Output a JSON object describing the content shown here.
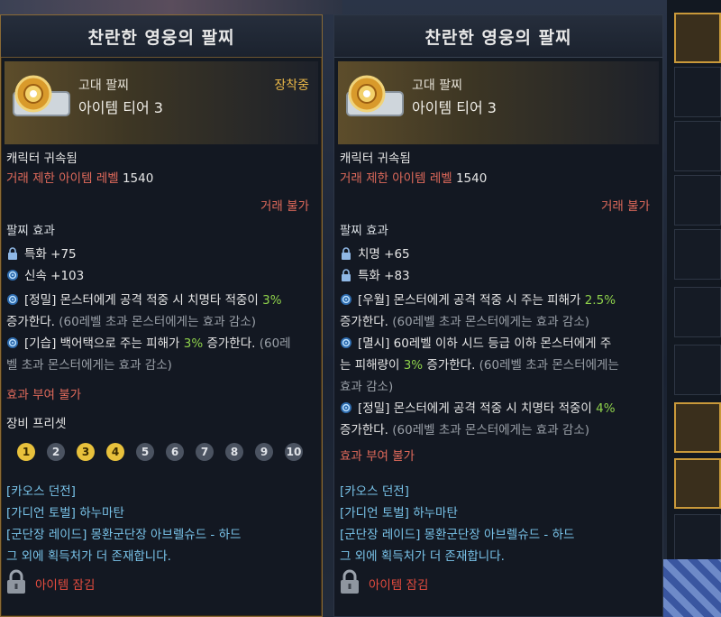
{
  "left": {
    "title": "찬란한 영웅의 팔찌",
    "grade": "고대 팔찌",
    "tier": "아이템 티어 3",
    "equipped": "장착중",
    "bound": "캐릭터 귀속됨",
    "level_label": "거래 제한 아이템 레벨",
    "level_value": "1540",
    "trade": "거래 불가",
    "effect_title": "팔찌 효과",
    "stats": [
      {
        "icon": "lock-icon",
        "text": "특화 +75"
      },
      {
        "icon": "swirl-icon",
        "text": "신속 +103"
      }
    ],
    "effects": [
      {
        "lead": "[정밀] 몬스터에게 공격 적중 시 치명타 적중이 ",
        "val": "3%",
        "line2": "증가한다.",
        "tail": " (60레벨 초과 몬스터에게는 효과 감소)"
      },
      {
        "lead": "[기습] 백어택으로 주는 피해가 ",
        "val": "3%",
        "mid": " 증가한다.",
        "tail": " (60레",
        "line2": "벨 초과 몬스터에게는 효과 감소)"
      }
    ],
    "no_grant": "효과 부여 불가",
    "preset_title": "장비 프리셋",
    "presets": [
      "1",
      "2",
      "3",
      "4",
      "5",
      "6",
      "7",
      "8",
      "9",
      "10"
    ],
    "presets_active": [
      1,
      3,
      4
    ],
    "sources": [
      "[카오스 던전]",
      "[가디언 토벌] 하누마탄",
      "[군단장 레이드] 몽환군단장 아브렐슈드 - 하드",
      "그 외에 획득처가 더 존재합니다."
    ],
    "lock_text": "아이템 잠김"
  },
  "right": {
    "title": "찬란한 영웅의 팔찌",
    "grade": "고대 팔찌",
    "tier": "아이템 티어 3",
    "bound": "캐릭터 귀속됨",
    "level_label": "거래 제한 아이템 레벨",
    "level_value": "1540",
    "trade": "거래 불가",
    "effect_title": "팔찌 효과",
    "stats": [
      {
        "icon": "lock-icon",
        "text": "치명 +65"
      },
      {
        "icon": "lock-icon",
        "text": "특화 +83"
      }
    ],
    "effect1": {
      "lead": "[우월] 몬스터에게 공격 적중 시 주는 피해가 ",
      "val": "2.5%",
      "line2": "증가한다.",
      "tail": " (60레벨 초과 몬스터에게는 효과 감소)"
    },
    "effect2": {
      "lead": "[멸시] 60레벨 이하 시드 등급 이하 몬스터에게 주",
      "line2a": "는 피해량이 ",
      "val": "3%",
      "mid": " 증가한다.",
      "tail": " (60레벨 초과 몬스터에게는",
      "line3": "효과 감소)"
    },
    "effect3": {
      "lead": "[정밀] 몬스터에게 공격 적중 시 치명타 적중이 ",
      "val": "4%",
      "line2": "증가한다.",
      "tail": " (60레벨 초과 몬스터에게는 효과 감소)"
    },
    "no_grant": "효과 부여 불가",
    "sources": [
      "[카오스 던전]",
      "[가디언 토벌] 하누마탄",
      "[군단장 레이드] 몽환군단장 아브렐슈드 - 하드",
      "그 외에 획득처가 더 존재합니다."
    ],
    "lock_text": "아이템 잠김"
  },
  "colors": {
    "accent_gold": "#e8b647",
    "red": "#e06a5b",
    "green": "#8ed14b",
    "blue": "#79c4ea",
    "preset_active": "#e8c13c"
  }
}
